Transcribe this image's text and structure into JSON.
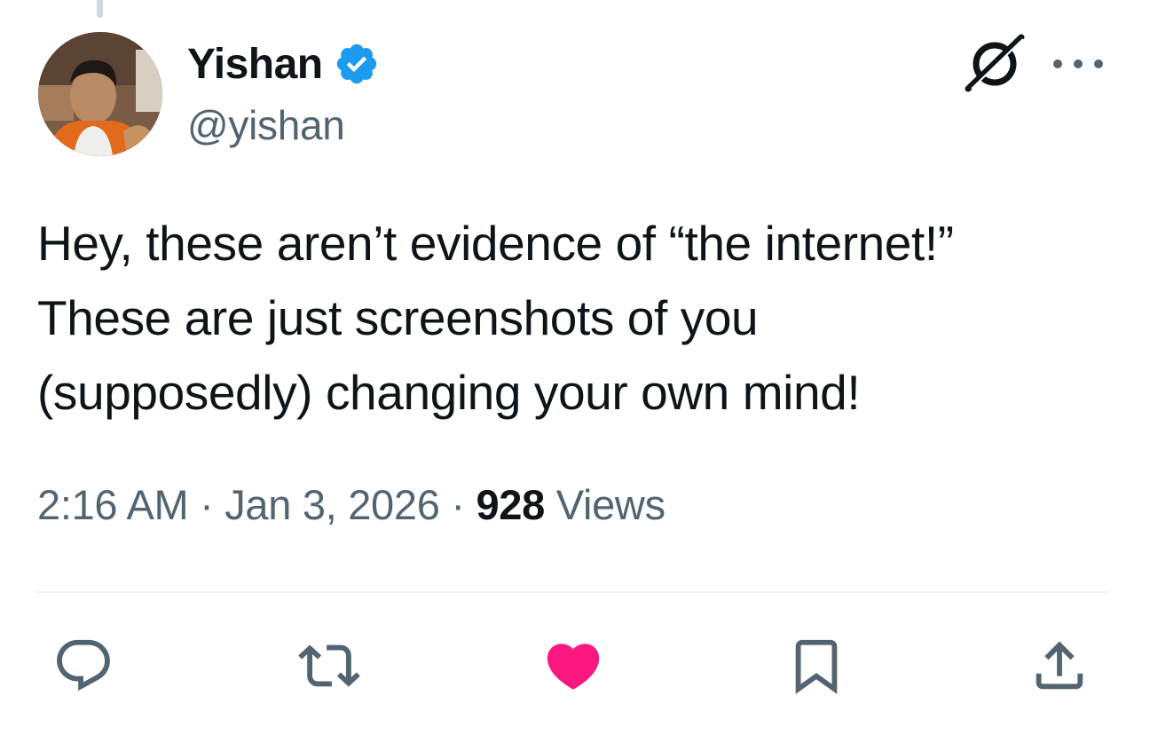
{
  "author": {
    "display_name": "Yishan",
    "handle": "@yishan",
    "verified": true,
    "avatar": "profile-photo"
  },
  "tweet": {
    "lines": [
      "Hey, these aren’t evidence of “the internet!”",
      "These are just screenshots of you",
      "(supposedly) changing your own mind!"
    ]
  },
  "meta": {
    "time": "2:16 AM",
    "separator": " · ",
    "date": "Jan 3, 2026",
    "views_count": "928",
    "views_label": " Views"
  },
  "header_icons": [
    "grok-icon",
    "more-icon"
  ],
  "actions": [
    {
      "name": "reply",
      "icon": "reply-icon"
    },
    {
      "name": "retweet",
      "icon": "retweet-icon"
    },
    {
      "name": "like",
      "icon": "heart-icon",
      "active": true
    },
    {
      "name": "bookmark",
      "icon": "bookmark-icon"
    },
    {
      "name": "share",
      "icon": "share-icon"
    }
  ],
  "colors": {
    "text": "#0f1419",
    "secondary": "#536471",
    "verified": "#1d9bf0",
    "like_active": "#f91880",
    "divider": "#eff3f4"
  }
}
